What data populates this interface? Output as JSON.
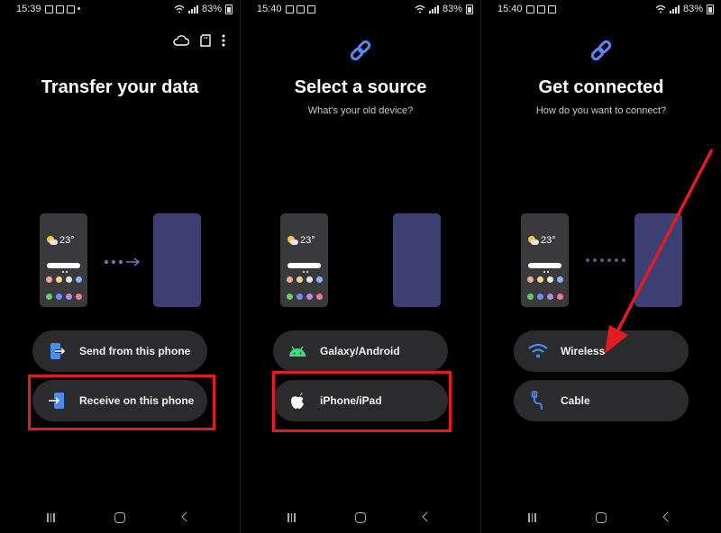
{
  "colors": {
    "background": "#000000",
    "button_bg": "#2b2b2d",
    "accent_blue": "#6f78c6",
    "highlight_red": "#e51b22",
    "android_green": "#3ddc84"
  },
  "panels": [
    {
      "status": {
        "time": "15:39",
        "battery": "83%"
      },
      "top_icons": [
        "cloud-icon",
        "sd-card-icon",
        "more-vert-icon"
      ],
      "title": "Transfer your data",
      "subtitle": "",
      "illustration": {
        "temperature": "23°",
        "connector": "arrow"
      },
      "buttons": [
        {
          "label": "Send from this phone",
          "icon": "send-phone-icon"
        },
        {
          "label": "Receive on this phone",
          "icon": "receive-phone-icon"
        }
      ],
      "highlighted_button": 1
    },
    {
      "status": {
        "time": "15:40",
        "battery": "83%"
      },
      "title": "Select a source",
      "subtitle": "What's your old device?",
      "illustration": {
        "temperature": "23°",
        "connector": "none"
      },
      "buttons": [
        {
          "label": "Galaxy/Android",
          "icon": "android-icon"
        },
        {
          "label": "iPhone/iPad",
          "icon": "apple-icon"
        }
      ],
      "highlighted_button": 1
    },
    {
      "status": {
        "time": "15:40",
        "battery": "83%"
      },
      "title": "Get connected",
      "subtitle": "How do you want to connect?",
      "illustration": {
        "temperature": "23°",
        "connector": "dots"
      },
      "buttons": [
        {
          "label": "Wireless",
          "icon": "wifi-icon"
        },
        {
          "label": "Cable",
          "icon": "usb-cable-icon"
        }
      ],
      "annotation": "red-arrow-pointing-to-wireless"
    }
  ],
  "navbar": {
    "icons": [
      "recent-apps-icon",
      "home-icon",
      "back-icon"
    ]
  }
}
